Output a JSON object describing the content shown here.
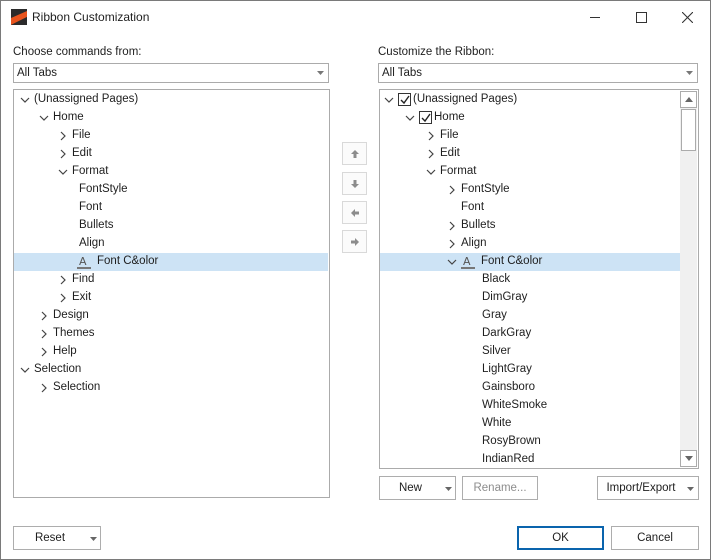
{
  "window": {
    "title": "Ribbon Customization"
  },
  "left": {
    "label": "Choose commands from:",
    "combo_value": "All Tabs",
    "tree": [
      {
        "text": "(Unassigned Pages)",
        "level": 0,
        "exp": "down"
      },
      {
        "text": "Home",
        "level": 1,
        "exp": "down"
      },
      {
        "text": "File",
        "level": 2,
        "exp": "right"
      },
      {
        "text": "Edit",
        "level": 2,
        "exp": "right"
      },
      {
        "text": "Format",
        "level": 2,
        "exp": "down"
      },
      {
        "text": "FontStyle",
        "level": 3,
        "exp": "none"
      },
      {
        "text": "Font",
        "level": 3,
        "exp": "none"
      },
      {
        "text": "Bullets",
        "level": 3,
        "exp": "none"
      },
      {
        "text": "Align",
        "level": 3,
        "exp": "none"
      },
      {
        "text": "Font C&olor",
        "level": 3,
        "exp": "none",
        "icon": "font-color-icon",
        "selected": true
      },
      {
        "text": "Find",
        "level": 2,
        "exp": "right"
      },
      {
        "text": "Exit",
        "level": 2,
        "exp": "right"
      },
      {
        "text": "Design",
        "level": 1,
        "exp": "right"
      },
      {
        "text": "Themes",
        "level": 1,
        "exp": "right"
      },
      {
        "text": "Help",
        "level": 1,
        "exp": "right"
      },
      {
        "text": "Selection",
        "level": 0,
        "exp": "down"
      },
      {
        "text": "Selection",
        "level": 1,
        "exp": "right"
      }
    ]
  },
  "right": {
    "label": "Customize the Ribbon:",
    "combo_value": "All Tabs",
    "tree": [
      {
        "text": "(Unassigned Pages)",
        "level": 0,
        "exp": "down",
        "checked": true
      },
      {
        "text": "Home",
        "level": 1,
        "exp": "down",
        "checked": true
      },
      {
        "text": "File",
        "level": 2,
        "exp": "right"
      },
      {
        "text": "Edit",
        "level": 2,
        "exp": "right"
      },
      {
        "text": "Format",
        "level": 2,
        "exp": "down"
      },
      {
        "text": "FontStyle",
        "level": 3,
        "exp": "right"
      },
      {
        "text": "Font",
        "level": 3,
        "exp": "none"
      },
      {
        "text": "Bullets",
        "level": 3,
        "exp": "right"
      },
      {
        "text": "Align",
        "level": 3,
        "exp": "right"
      },
      {
        "text": "Font C&olor",
        "level": 3,
        "exp": "down",
        "icon": "font-color-icon",
        "selected": true
      },
      {
        "text": "Black",
        "level": 4,
        "exp": "none"
      },
      {
        "text": "DimGray",
        "level": 4,
        "exp": "none"
      },
      {
        "text": "Gray",
        "level": 4,
        "exp": "none"
      },
      {
        "text": "DarkGray",
        "level": 4,
        "exp": "none"
      },
      {
        "text": "Silver",
        "level": 4,
        "exp": "none"
      },
      {
        "text": "LightGray",
        "level": 4,
        "exp": "none"
      },
      {
        "text": "Gainsboro",
        "level": 4,
        "exp": "none"
      },
      {
        "text": "WhiteSmoke",
        "level": 4,
        "exp": "none"
      },
      {
        "text": "White",
        "level": 4,
        "exp": "none"
      },
      {
        "text": "RosyBrown",
        "level": 4,
        "exp": "none"
      },
      {
        "text": "IndianRed",
        "level": 4,
        "exp": "none"
      }
    ]
  },
  "buttons": {
    "new": "New",
    "rename": "Rename...",
    "import_export": "Import/Export",
    "reset": "Reset",
    "ok": "OK",
    "cancel": "Cancel"
  },
  "colors": {
    "selection": "#cde3f5",
    "accent": "#0a64ad",
    "border": "#ababab"
  }
}
